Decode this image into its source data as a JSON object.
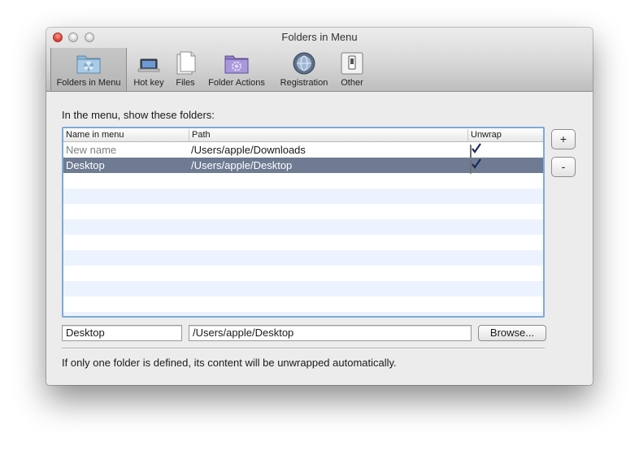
{
  "window": {
    "title": "Folders in Menu"
  },
  "toolbar": {
    "items": [
      {
        "label": "Folders in Menu",
        "icon": "folder-radiation-icon",
        "selected": true
      },
      {
        "label": "Hot key",
        "icon": "keyboard-icon",
        "selected": false
      },
      {
        "label": "Files",
        "icon": "documents-icon",
        "selected": false
      },
      {
        "label": "Folder Actions",
        "icon": "folder-actions-icon",
        "selected": false
      },
      {
        "label": "Registration",
        "icon": "registration-globe-icon",
        "selected": false
      },
      {
        "label": "Other",
        "icon": "switch-icon",
        "selected": false
      }
    ]
  },
  "main": {
    "intro": "In the menu, show these folders:",
    "table": {
      "columns": [
        "Name in menu",
        "Path",
        "Unwrap"
      ],
      "rows": [
        {
          "name": "New name",
          "path": "/Users/apple/Downloads",
          "unwrap": true,
          "placeholder": true
        },
        {
          "name": "Desktop",
          "path": "/Users/apple/Desktop",
          "unwrap": true,
          "selected": true
        }
      ]
    },
    "add_button": "+",
    "remove_button": "-",
    "name_field": "Desktop",
    "path_field": "/Users/apple/Desktop",
    "browse_button": "Browse...",
    "note": "If only one folder is defined, its content will be unwrapped automatically."
  },
  "colors": {
    "selection": "#6e7b92",
    "table_focus_ring": "#7ea9dc",
    "alt_row": "#edf3fe"
  }
}
